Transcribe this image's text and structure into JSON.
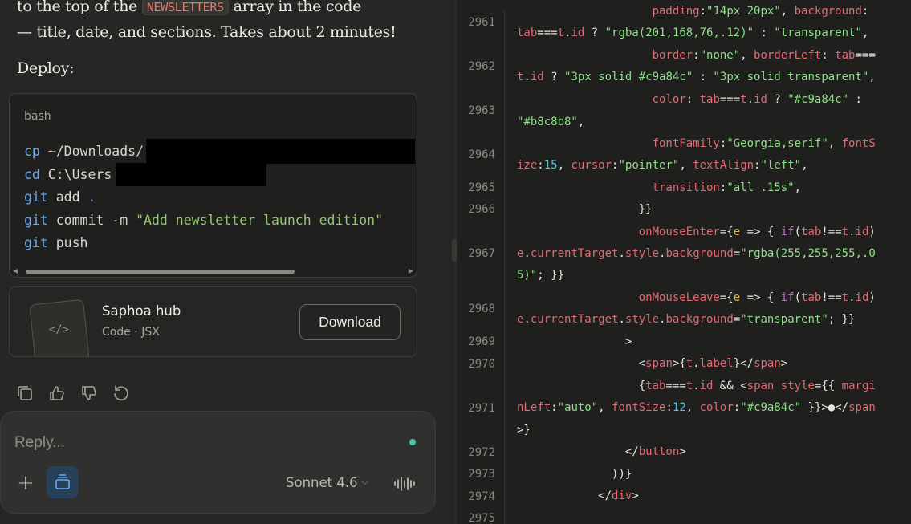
{
  "chat": {
    "prose_line1_pre": "to the top of the",
    "prose_code": "NEWSLETTERS",
    "prose_line1_post": "array in the code",
    "prose_line2": "— title, date, and sections. Takes about 2 minutes!",
    "deploy_label": "Deploy:",
    "code_block": {
      "language": "bash",
      "lines": [
        {
          "cmd": "cp",
          "rest": " ~/Downloads/"
        },
        {
          "cmd": "cd",
          "rest": " C:\\Users"
        },
        {
          "cmd": "git",
          "rest": " add ",
          "tail": "."
        },
        {
          "cmd": "git",
          "rest": " commit -m ",
          "str": "\"Add newsletter launch edition\""
        },
        {
          "cmd": "git",
          "rest": " push"
        }
      ]
    },
    "artifact": {
      "title": "Saphoa hub",
      "subtitle": "Code · JSX",
      "download_label": "Download",
      "thumb_glyph": "</>"
    },
    "actions": [
      "copy-icon",
      "thumbs-up-icon",
      "thumbs-down-icon",
      "retry-icon"
    ],
    "composer": {
      "placeholder": "Reply...",
      "model": "Sonnet 4.6",
      "plus_glyph": "+"
    }
  },
  "editor": {
    "lines": [
      {
        "n": "",
        "segs": [
          [
            "s",
            "                    "
          ],
          [
            "k",
            "padding"
          ],
          [
            "p",
            ":"
          ],
          [
            "q",
            "\"14px 20px\""
          ],
          [
            "p",
            ", "
          ],
          [
            "k",
            "background"
          ],
          [
            "p",
            ":"
          ]
        ]
      },
      {
        "n": "2961",
        "segs": [
          [
            "k",
            "tab"
          ],
          [
            "p",
            "==="
          ],
          [
            "k",
            "t"
          ],
          [
            "p",
            "."
          ],
          [
            "k",
            "id"
          ],
          [
            "p",
            " ? "
          ],
          [
            "q",
            "\"rgba(201,168,76,.12)\""
          ],
          [
            "p",
            " : "
          ],
          [
            "q",
            "\"transparent\""
          ],
          [
            "p",
            ","
          ]
        ]
      },
      {
        "n": "",
        "segs": [
          [
            "s",
            "                    "
          ],
          [
            "k",
            "border"
          ],
          [
            "p",
            ":"
          ],
          [
            "q",
            "\"none\""
          ],
          [
            "p",
            ", "
          ],
          [
            "k",
            "borderLeft"
          ],
          [
            "p",
            ": "
          ],
          [
            "k",
            "tab"
          ],
          [
            "p",
            "==="
          ]
        ]
      },
      {
        "n": "2962",
        "segs": [
          [
            "k",
            "t"
          ],
          [
            "p",
            "."
          ],
          [
            "k",
            "id"
          ],
          [
            "p",
            " ? "
          ],
          [
            "q",
            "\"3px solid #c9a84c\""
          ],
          [
            "p",
            " : "
          ],
          [
            "q",
            "\"3px solid transparent\""
          ],
          [
            "p",
            ","
          ]
        ]
      },
      {
        "n": "",
        "segs": [
          [
            "s",
            "                    "
          ],
          [
            "k",
            "color"
          ],
          [
            "p",
            ": "
          ],
          [
            "k",
            "tab"
          ],
          [
            "p",
            "==="
          ],
          [
            "k",
            "t"
          ],
          [
            "p",
            "."
          ],
          [
            "k",
            "id"
          ],
          [
            "p",
            " ? "
          ],
          [
            "q",
            "\"#c9a84c\""
          ],
          [
            "p",
            " :"
          ]
        ]
      },
      {
        "n": "2963",
        "segs": [
          [
            "q",
            "\"#b8c8b8\""
          ],
          [
            "p",
            ","
          ]
        ]
      },
      {
        "n": "",
        "segs": [
          [
            "s",
            "                    "
          ],
          [
            "k",
            "fontFamily"
          ],
          [
            "p",
            ":"
          ],
          [
            "q",
            "\"Georgia,serif\""
          ],
          [
            "p",
            ", "
          ],
          [
            "k",
            "fontS"
          ]
        ]
      },
      {
        "n": "2964",
        "segs": [
          [
            "k",
            "ize"
          ],
          [
            "p",
            ":"
          ],
          [
            "n",
            "15"
          ],
          [
            "p",
            ", "
          ],
          [
            "k",
            "cursor"
          ],
          [
            "p",
            ":"
          ],
          [
            "q",
            "\"pointer\""
          ],
          [
            "p",
            ", "
          ],
          [
            "k",
            "textAlign"
          ],
          [
            "p",
            ":"
          ],
          [
            "q",
            "\"left\""
          ],
          [
            "p",
            ","
          ]
        ]
      },
      {
        "n": "2965",
        "segs": [
          [
            "s",
            "                    "
          ],
          [
            "k",
            "transition"
          ],
          [
            "p",
            ":"
          ],
          [
            "q",
            "\"all .15s\""
          ],
          [
            "p",
            ","
          ]
        ]
      },
      {
        "n": "2966",
        "segs": [
          [
            "s",
            "                  "
          ],
          [
            "p",
            "}}"
          ]
        ]
      },
      {
        "n": "",
        "segs": [
          [
            "s",
            "                  "
          ],
          [
            "k",
            "onMouseEnter"
          ],
          [
            "p",
            "={"
          ],
          [
            "v",
            "e"
          ],
          [
            "p",
            " => { "
          ],
          [
            "c",
            "if"
          ],
          [
            "p",
            "("
          ],
          [
            "k",
            "tab"
          ],
          [
            "p",
            "!=="
          ],
          [
            "k",
            "t"
          ],
          [
            "p",
            "."
          ],
          [
            "k",
            "id"
          ],
          [
            "p",
            ")"
          ]
        ]
      },
      {
        "n": "2967",
        "segs": [
          [
            "k",
            "e"
          ],
          [
            "p",
            "."
          ],
          [
            "k",
            "currentTarget"
          ],
          [
            "p",
            "."
          ],
          [
            "k",
            "style"
          ],
          [
            "p",
            "."
          ],
          [
            "k",
            "background"
          ],
          [
            "p",
            "="
          ],
          [
            "q",
            "\"rgba(255,255,255,.0"
          ]
        ]
      },
      {
        "n": "",
        "segs": [
          [
            "q",
            "5)\""
          ],
          [
            "p",
            "; }}"
          ]
        ]
      },
      {
        "n": "",
        "segs": [
          [
            "s",
            "                  "
          ],
          [
            "k",
            "onMouseLeave"
          ],
          [
            "p",
            "={"
          ],
          [
            "v",
            "e"
          ],
          [
            "p",
            " => { "
          ],
          [
            "c",
            "if"
          ],
          [
            "p",
            "("
          ],
          [
            "k",
            "tab"
          ],
          [
            "p",
            "!=="
          ],
          [
            "k",
            "t"
          ],
          [
            "p",
            "."
          ],
          [
            "k",
            "id"
          ],
          [
            "p",
            ")"
          ]
        ]
      },
      {
        "n": "2968",
        "segs": [
          [
            "k",
            "e"
          ],
          [
            "p",
            "."
          ],
          [
            "k",
            "currentTarget"
          ],
          [
            "p",
            "."
          ],
          [
            "k",
            "style"
          ],
          [
            "p",
            "."
          ],
          [
            "k",
            "background"
          ],
          [
            "p",
            "="
          ],
          [
            "q",
            "\"transparent\""
          ],
          [
            "p",
            "; }}"
          ]
        ]
      },
      {
        "n": "2969",
        "segs": [
          [
            "s",
            "                "
          ],
          [
            "p",
            ">"
          ]
        ]
      },
      {
        "n": "2970",
        "segs": [
          [
            "s",
            "                  "
          ],
          [
            "p",
            "<"
          ],
          [
            "t",
            "span"
          ],
          [
            "p",
            ">{"
          ],
          [
            "k",
            "t"
          ],
          [
            "p",
            "."
          ],
          [
            "k",
            "label"
          ],
          [
            "p",
            "}</"
          ],
          [
            "t",
            "span"
          ],
          [
            "p",
            ">"
          ]
        ]
      },
      {
        "n": "",
        "segs": [
          [
            "s",
            "                  "
          ],
          [
            "p",
            "{"
          ],
          [
            "k",
            "tab"
          ],
          [
            "p",
            "==="
          ],
          [
            "k",
            "t"
          ],
          [
            "p",
            "."
          ],
          [
            "k",
            "id"
          ],
          [
            "p",
            " && <"
          ],
          [
            "t",
            "span"
          ],
          [
            "p",
            " "
          ],
          [
            "k",
            "style"
          ],
          [
            "p",
            "={{ "
          ],
          [
            "k",
            "margi"
          ]
        ]
      },
      {
        "n": "2971",
        "segs": [
          [
            "k",
            "nLeft"
          ],
          [
            "p",
            ":"
          ],
          [
            "q",
            "\"auto\""
          ],
          [
            "p",
            ", "
          ],
          [
            "k",
            "fontSize"
          ],
          [
            "p",
            ":"
          ],
          [
            "n",
            "12"
          ],
          [
            "p",
            ", "
          ],
          [
            "k",
            "color"
          ],
          [
            "p",
            ":"
          ],
          [
            "q",
            "\"#c9a84c\""
          ],
          [
            "p",
            " }}>●</"
          ],
          [
            "t",
            "span"
          ]
        ]
      },
      {
        "n": "",
        "segs": [
          [
            "p",
            ">}"
          ]
        ]
      },
      {
        "n": "2972",
        "segs": [
          [
            "s",
            "                "
          ],
          [
            "p",
            "</"
          ],
          [
            "t",
            "button"
          ],
          [
            "p",
            ">"
          ]
        ]
      },
      {
        "n": "2973",
        "segs": [
          [
            "s",
            "              "
          ],
          [
            "p",
            "))}"
          ]
        ]
      },
      {
        "n": "2974",
        "segs": [
          [
            "s",
            "            "
          ],
          [
            "p",
            "</"
          ],
          [
            "t",
            "div"
          ],
          [
            "p",
            ">"
          ]
        ]
      },
      {
        "n": "2975",
        "segs": [
          [
            "s",
            ""
          ]
        ]
      }
    ]
  },
  "colors": {
    "background": "#262624",
    "editor_background": "#1f1f1d",
    "accent_blue": "#26405a",
    "status_dot": "#4cc1a6"
  }
}
